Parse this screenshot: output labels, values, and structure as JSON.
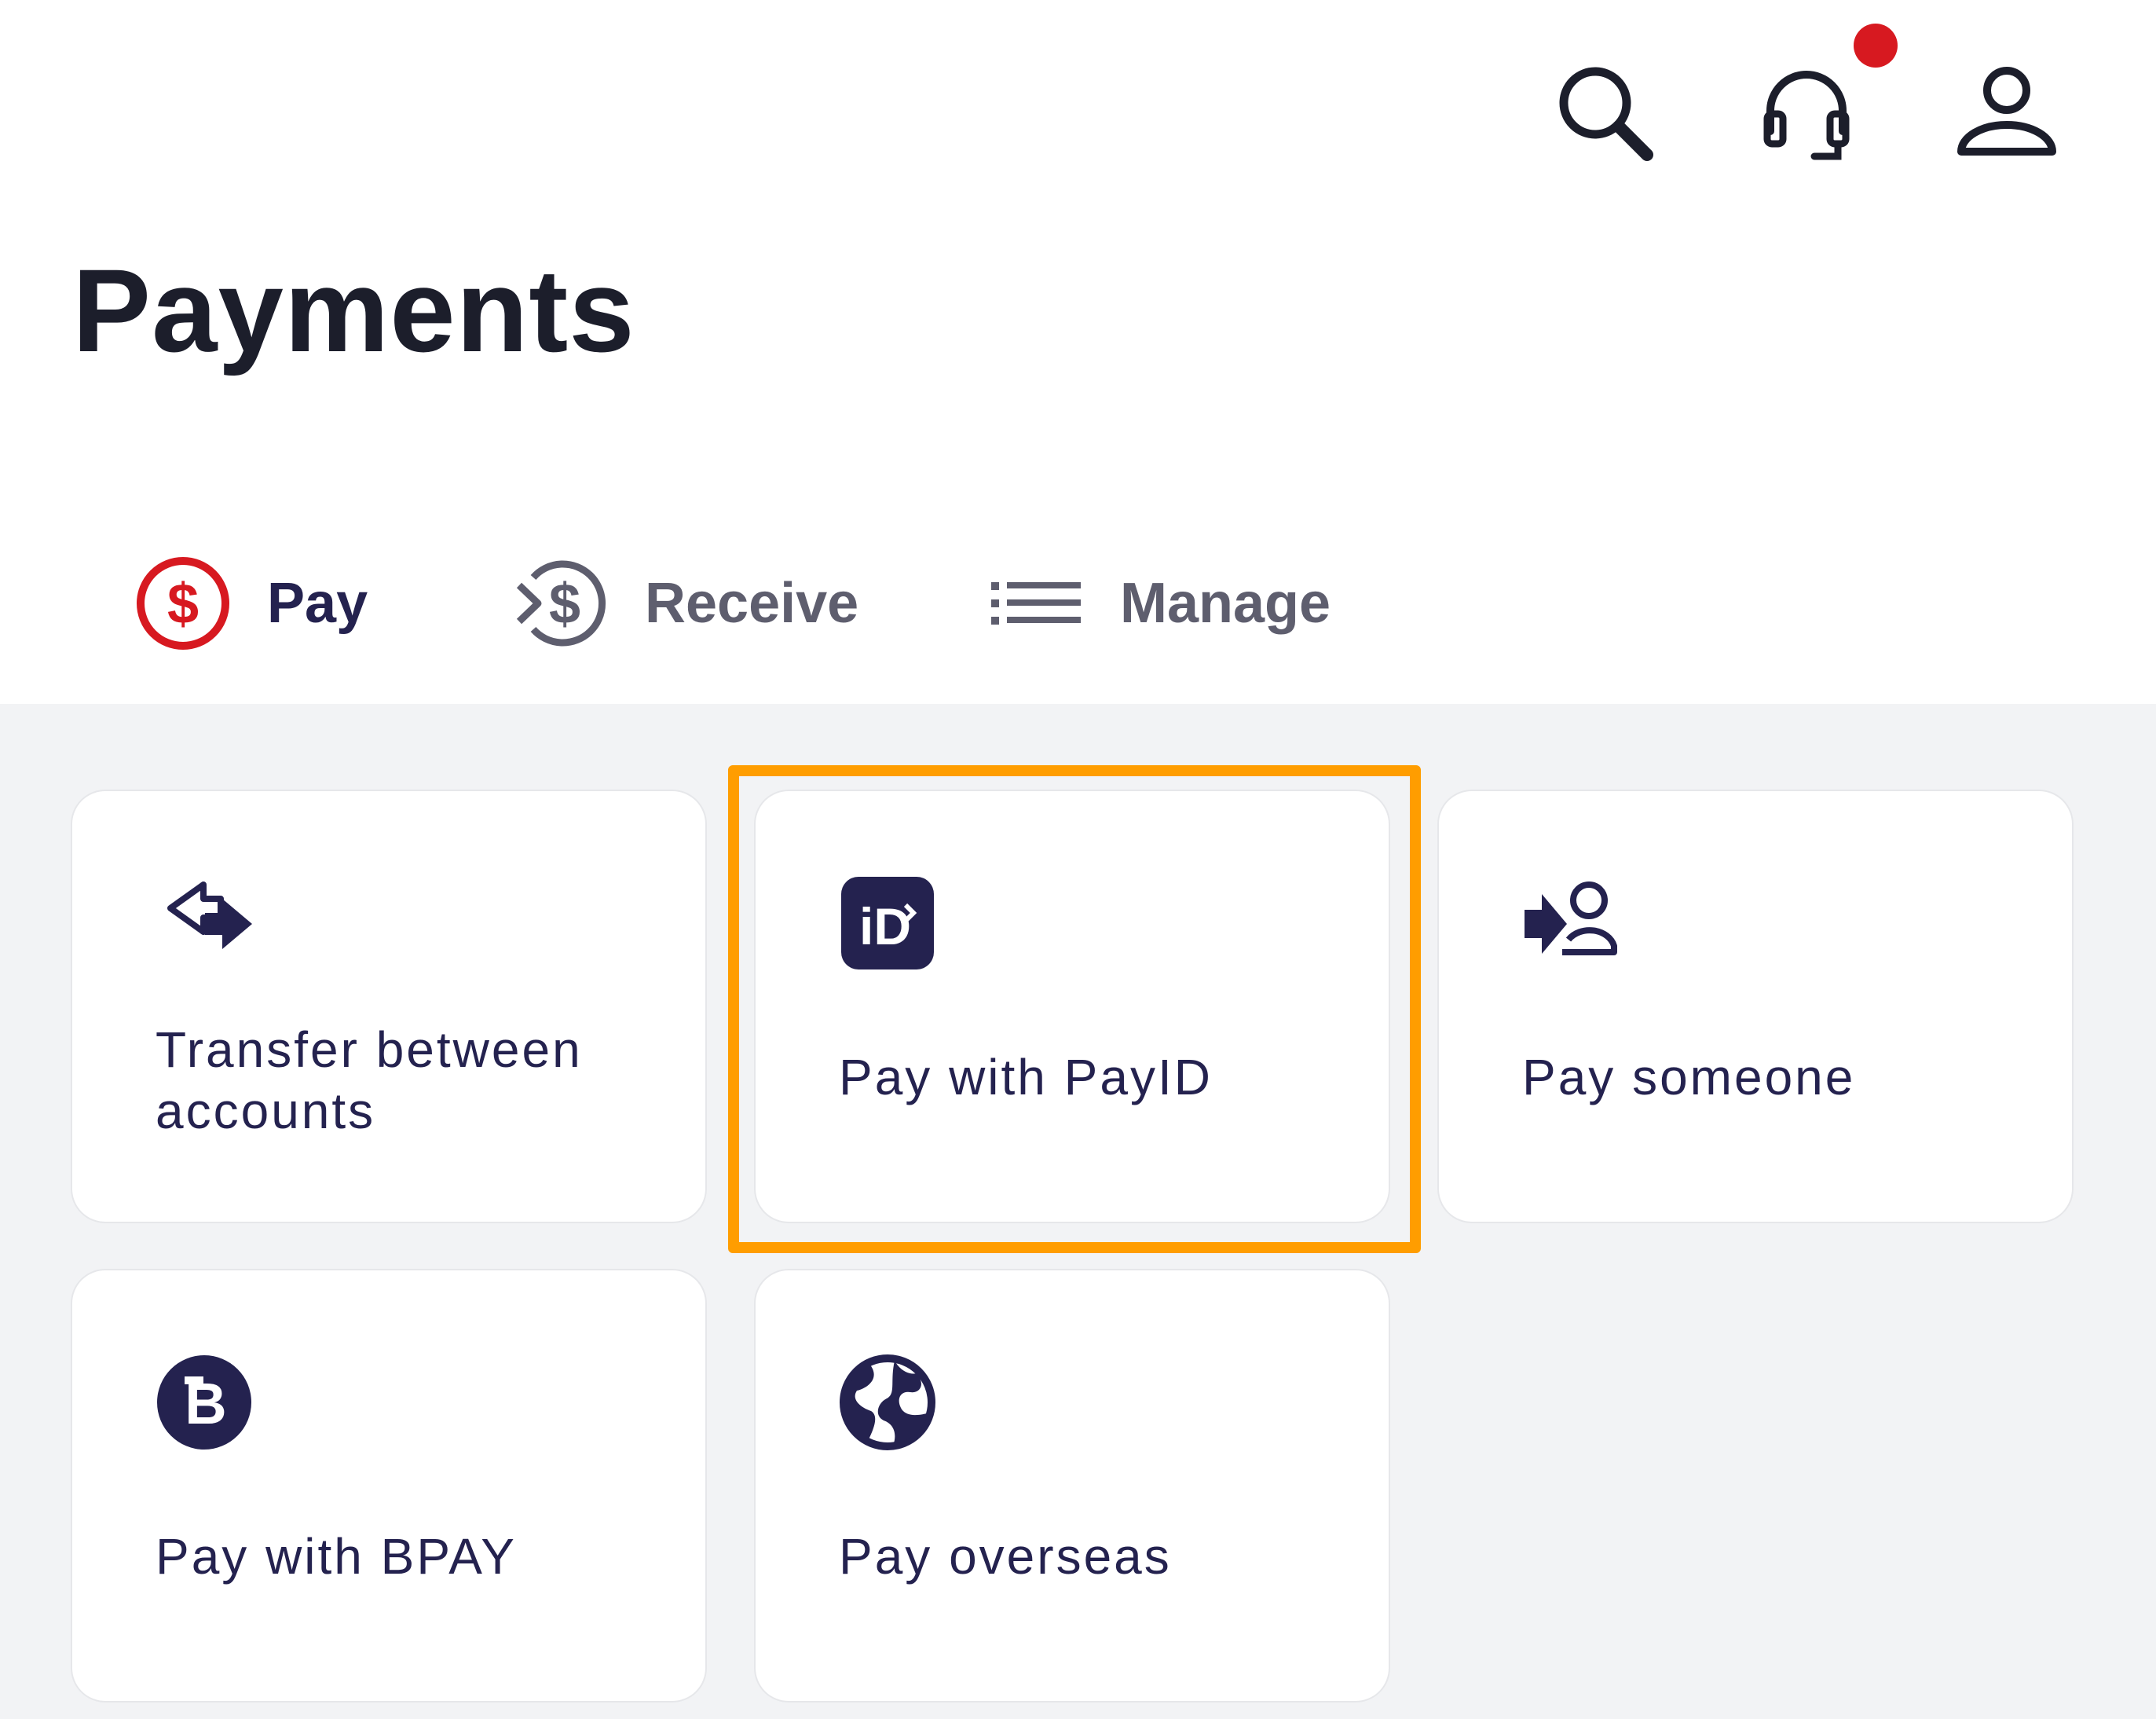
{
  "page": {
    "title": "Payments"
  },
  "header": {
    "icons": [
      "search-icon",
      "headset-icon",
      "user-icon"
    ],
    "notification_color": "#d71920"
  },
  "tabs": [
    {
      "label": "Pay",
      "icon": "dollar-circle-icon",
      "selected": true
    },
    {
      "label": "Receive",
      "icon": "receive-dollar-icon",
      "selected": false
    },
    {
      "label": "Manage",
      "icon": "list-icon",
      "selected": false
    }
  ],
  "actions": [
    {
      "label": "Transfer between accounts",
      "icon": "transfer-arrows-icon"
    },
    {
      "label": "Pay with PayID",
      "icon": "payid-icon",
      "highlighted": true
    },
    {
      "label": "Pay someone",
      "icon": "pay-person-icon"
    },
    {
      "label": "Pay with BPAY",
      "icon": "bpay-icon"
    },
    {
      "label": "Pay overseas",
      "icon": "globe-icon"
    }
  ],
  "colors": {
    "brand_navy": "#24224f",
    "accent_red": "#d71920",
    "highlight_orange": "#ff9d00",
    "background": "#f2f3f5"
  }
}
